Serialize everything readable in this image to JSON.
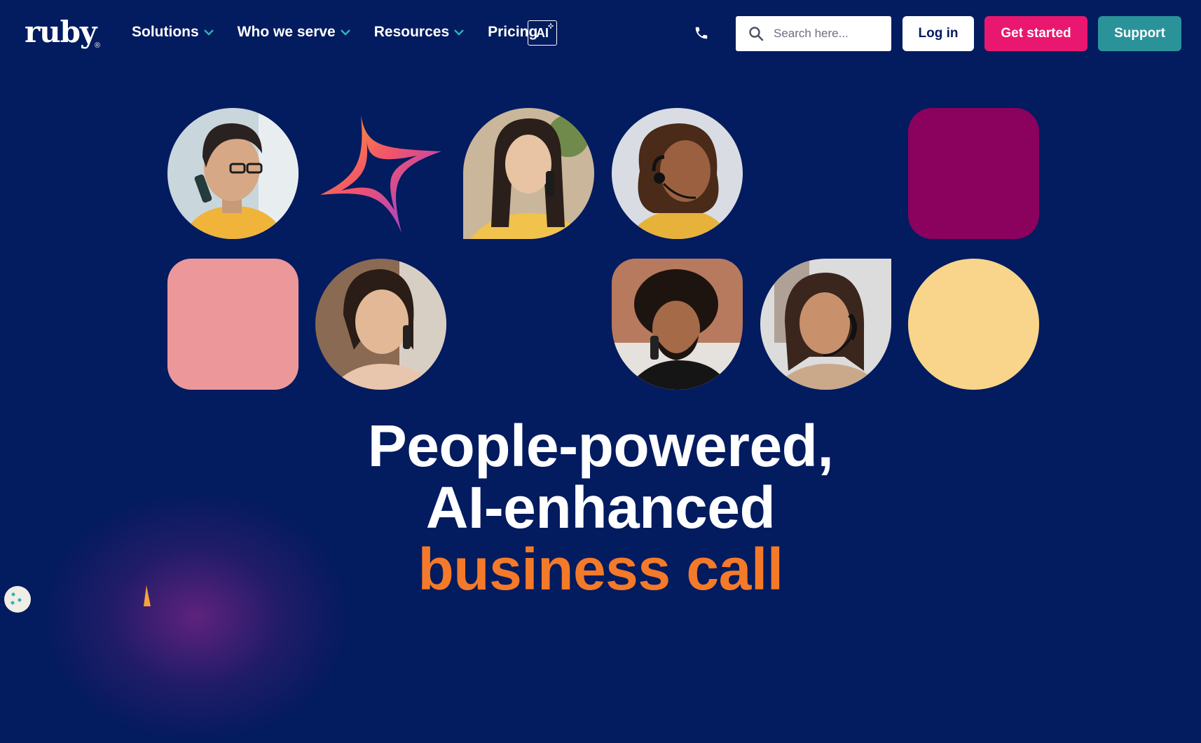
{
  "brand": {
    "logo_text": "ruby",
    "registered": "®"
  },
  "nav": {
    "items": [
      {
        "label": "Solutions",
        "has_dropdown": true
      },
      {
        "label": "Who we serve",
        "has_dropdown": true
      },
      {
        "label": "Resources",
        "has_dropdown": true
      },
      {
        "label": "Pricing",
        "has_dropdown": false
      }
    ],
    "ai_badge": "AI"
  },
  "header": {
    "phone_icon": "phone-icon",
    "search": {
      "placeholder": "Search here...",
      "value": ""
    },
    "login_label": "Log in",
    "get_started_label": "Get started",
    "support_label": "Support"
  },
  "hero": {
    "line1": "People-powered,",
    "line2": "AI-enhanced",
    "line3": "business call"
  },
  "colors": {
    "background": "#031b5f",
    "accent_pink": "#e9176f",
    "accent_teal": "#2a9399",
    "accent_orange": "#f47a2a",
    "tile_magenta": "#8a015e",
    "tile_pink": "#ec989a",
    "tile_yellow": "#f8d58b"
  }
}
